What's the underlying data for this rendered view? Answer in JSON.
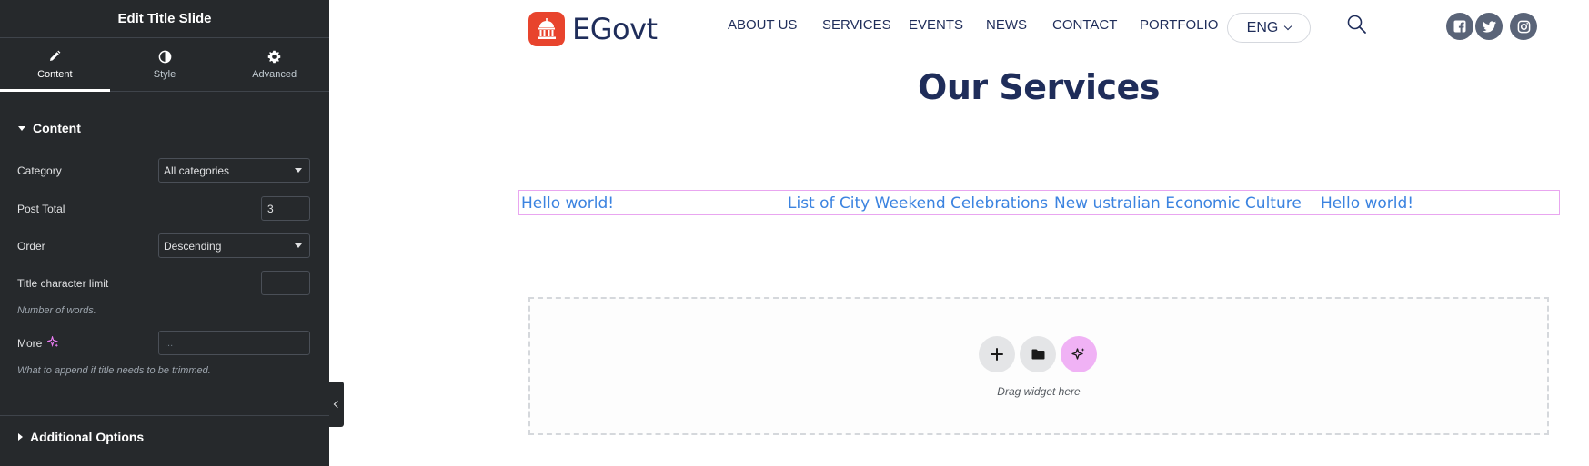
{
  "panel": {
    "title": "Edit Title Slide",
    "tabs": [
      {
        "label": "Content",
        "icon": "pencil-icon",
        "active": true
      },
      {
        "label": "Style",
        "icon": "contrast-icon",
        "active": false
      },
      {
        "label": "Advanced",
        "icon": "gear-icon",
        "active": false
      }
    ],
    "content_section": {
      "title": "Content",
      "category": {
        "label": "Category",
        "value": "All categories"
      },
      "post_total": {
        "label": "Post Total",
        "value": "3"
      },
      "order": {
        "label": "Order",
        "value": "Descending"
      },
      "title_limit": {
        "label": "Title character limit",
        "value": "",
        "help": "Number of words."
      },
      "more": {
        "label": "More",
        "placeholder": "...",
        "help": "What to append if title needs to be trimmed."
      }
    },
    "additional_section": {
      "title": "Additional Options"
    }
  },
  "site": {
    "logo_text": "EGovt",
    "nav": [
      "ABOUT US",
      "SERVICES",
      "EVENTS",
      "NEWS",
      "CONTACT",
      "PORTFOLIO"
    ],
    "lang": "ENG",
    "social_icons": [
      "facebook-icon",
      "twitter-icon",
      "instagram-icon"
    ],
    "services_title": "Our Services",
    "slides": [
      "Hello world!",
      "List of City Weekend Celebrations",
      "New ustralian Economic Culture",
      "Hello world!"
    ],
    "drop_zone_text": "Drag widget here"
  },
  "colors": {
    "panel_bg": "#26292c",
    "brand_navy": "#1f2d5a",
    "logo_red": "#e8442d",
    "link_blue": "#3b83e0",
    "ai_pink": "#f0b2f5"
  }
}
